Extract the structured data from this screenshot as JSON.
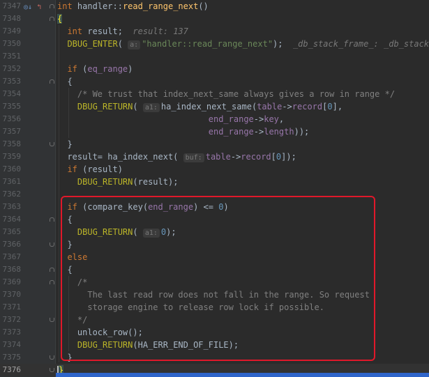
{
  "editor": {
    "gutter_icons": {
      "override": "◎↓",
      "implements": "↰"
    },
    "lines": [
      {
        "n": "7347",
        "tokens": [
          [
            "kw",
            "int"
          ],
          [
            "p",
            " "
          ],
          [
            "p",
            "handler::"
          ],
          [
            "fn",
            "read_range_next"
          ],
          [
            "p",
            "()"
          ]
        ]
      },
      {
        "n": "7348",
        "tokens": [
          [
            "bracket",
            "{"
          ]
        ]
      },
      {
        "n": "7349",
        "tokens": [
          [
            "p",
            "  "
          ],
          [
            "kw",
            "int"
          ],
          [
            "p",
            " result;  "
          ],
          [
            "hint",
            "result: 137"
          ]
        ]
      },
      {
        "n": "7350",
        "tokens": [
          [
            "p",
            "  "
          ],
          [
            "macro",
            "DBUG_ENTER"
          ],
          [
            "p",
            "( "
          ],
          [
            "ph",
            "a:"
          ],
          [
            "str",
            "\"handler::read_range_next\""
          ],
          [
            "p",
            ");  "
          ],
          [
            "hint",
            "_db_stack_frame_: _db_stack_fr"
          ]
        ]
      },
      {
        "n": "7351",
        "tokens": []
      },
      {
        "n": "7352",
        "tokens": [
          [
            "p",
            "  "
          ],
          [
            "kw",
            "if"
          ],
          [
            "p",
            " ("
          ],
          [
            "fld",
            "eq_range"
          ],
          [
            "p",
            ")"
          ]
        ]
      },
      {
        "n": "7353",
        "tokens": [
          [
            "p",
            "  {"
          ]
        ]
      },
      {
        "n": "7354",
        "tokens": [
          [
            "p",
            "    "
          ],
          [
            "cmt",
            "/* We trust that index_next_same always gives a row in range */"
          ]
        ]
      },
      {
        "n": "7355",
        "tokens": [
          [
            "p",
            "    "
          ],
          [
            "macro",
            "DBUG_RETURN"
          ],
          [
            "p",
            "( "
          ],
          [
            "ph",
            "a1:"
          ],
          [
            "p",
            "ha_index_next_same("
          ],
          [
            "fld",
            "table"
          ],
          [
            "p",
            "->"
          ],
          [
            "fld",
            "record"
          ],
          [
            "p",
            "["
          ],
          [
            "num",
            "0"
          ],
          [
            "p",
            "],"
          ]
        ]
      },
      {
        "n": "7356",
        "tokens": [
          [
            "p",
            "                              "
          ],
          [
            "fld",
            "end_range"
          ],
          [
            "p",
            "->"
          ],
          [
            "fld",
            "key"
          ],
          [
            "p",
            ","
          ]
        ]
      },
      {
        "n": "7357",
        "tokens": [
          [
            "p",
            "                              "
          ],
          [
            "fld",
            "end_range"
          ],
          [
            "p",
            "->"
          ],
          [
            "fld",
            "length"
          ],
          [
            "p",
            "));"
          ]
        ]
      },
      {
        "n": "7358",
        "tokens": [
          [
            "p",
            "  }"
          ]
        ]
      },
      {
        "n": "7359",
        "tokens": [
          [
            "p",
            "  result= ha_index_next( "
          ],
          [
            "ph",
            "buf:"
          ],
          [
            "fld",
            "table"
          ],
          [
            "p",
            "->"
          ],
          [
            "fld",
            "record"
          ],
          [
            "p",
            "["
          ],
          [
            "num",
            "0"
          ],
          [
            "p",
            "]);"
          ]
        ]
      },
      {
        "n": "7360",
        "tokens": [
          [
            "p",
            "  "
          ],
          [
            "kw",
            "if"
          ],
          [
            "p",
            " (result)"
          ]
        ]
      },
      {
        "n": "7361",
        "tokens": [
          [
            "p",
            "    "
          ],
          [
            "macro",
            "DBUG_RETURN"
          ],
          [
            "p",
            "(result);"
          ]
        ]
      },
      {
        "n": "7362",
        "tokens": []
      },
      {
        "n": "7363",
        "tokens": [
          [
            "p",
            "  "
          ],
          [
            "kw",
            "if"
          ],
          [
            "p",
            " (compare_key("
          ],
          [
            "fld",
            "end_range"
          ],
          [
            "p",
            ") <= "
          ],
          [
            "num",
            "0"
          ],
          [
            "p",
            ")"
          ]
        ]
      },
      {
        "n": "7364",
        "tokens": [
          [
            "p",
            "  {"
          ]
        ]
      },
      {
        "n": "7365",
        "tokens": [
          [
            "p",
            "    "
          ],
          [
            "macro",
            "DBUG_RETURN"
          ],
          [
            "p",
            "( "
          ],
          [
            "ph",
            "a1:"
          ],
          [
            "num",
            "0"
          ],
          [
            "p",
            ");"
          ]
        ]
      },
      {
        "n": "7366",
        "tokens": [
          [
            "p",
            "  }"
          ]
        ]
      },
      {
        "n": "7367",
        "tokens": [
          [
            "p",
            "  "
          ],
          [
            "kw",
            "else"
          ]
        ]
      },
      {
        "n": "7368",
        "tokens": [
          [
            "p",
            "  {"
          ]
        ]
      },
      {
        "n": "7369",
        "tokens": [
          [
            "p",
            "    "
          ],
          [
            "cmt",
            "/*"
          ]
        ]
      },
      {
        "n": "7370",
        "tokens": [
          [
            "p",
            "      "
          ],
          [
            "cmt",
            "The last read row does not fall in the range. So request"
          ]
        ]
      },
      {
        "n": "7371",
        "tokens": [
          [
            "p",
            "      "
          ],
          [
            "cmt",
            "storage engine to release row lock if possible."
          ]
        ]
      },
      {
        "n": "7372",
        "tokens": [
          [
            "p",
            "    "
          ],
          [
            "cmt",
            "*/"
          ]
        ]
      },
      {
        "n": "7373",
        "tokens": [
          [
            "p",
            "    unlock_row();"
          ]
        ]
      },
      {
        "n": "7374",
        "tokens": [
          [
            "p",
            "    "
          ],
          [
            "macro",
            "DBUG_RETURN"
          ],
          [
            "p",
            "(HA_ERR_END_OF_FILE);"
          ]
        ]
      },
      {
        "n": "7375",
        "tokens": [
          [
            "p",
            "  }"
          ]
        ]
      },
      {
        "n": "7376",
        "tokens": [
          [
            "caret",
            ""
          ],
          [
            "bracket",
            "}"
          ]
        ],
        "current": true
      }
    ],
    "highlight_color": "#e1182a"
  }
}
